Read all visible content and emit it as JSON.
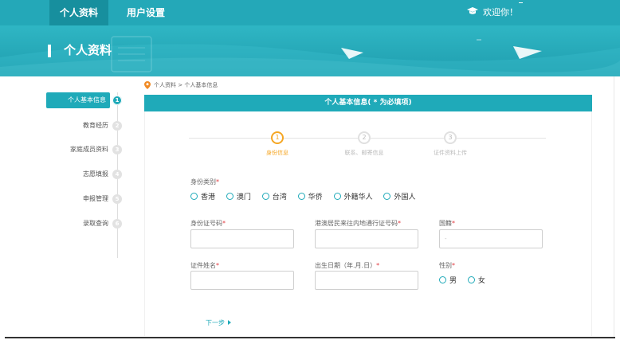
{
  "topbar": {
    "tabs": [
      {
        "label": "个人资料",
        "active": true
      },
      {
        "label": "用户设置",
        "active": false
      }
    ],
    "welcome": "欢迎你！"
  },
  "banner": {
    "title": "个人资料"
  },
  "sidebar": {
    "items": [
      {
        "label": "个人基本信息",
        "num": "1",
        "active": true
      },
      {
        "label": "教育经历",
        "num": "2",
        "active": false
      },
      {
        "label": "家庭成员资料",
        "num": "3",
        "active": false
      },
      {
        "label": "志愿填报",
        "num": "4",
        "active": false
      },
      {
        "label": "申报管理",
        "num": "5",
        "active": false
      },
      {
        "label": "录取查询",
        "num": "6",
        "active": false
      }
    ]
  },
  "breadcrumb": "个人资料 > 个人基本信息",
  "card": {
    "title": "个人基本信息( * 为必填项)"
  },
  "steps": [
    {
      "num": "1",
      "label": "身份信息",
      "active": true
    },
    {
      "num": "2",
      "label": "联系、邮寄信息",
      "active": false
    },
    {
      "num": "3",
      "label": "证件资料上传",
      "active": false
    }
  ],
  "form": {
    "identity_type_label": "身份类别",
    "identity_options": [
      "香港",
      "澳门",
      "台湾",
      "华侨",
      "外籍华人",
      "外国人"
    ],
    "id_number_label": "身份证号码",
    "permit_number_label": "港澳居民来往内地通行证号码",
    "nationality_label": "国籍",
    "nationality_value": "-",
    "cert_name_label": "证件姓名",
    "birthdate_label": "出生日期（年.月.日）",
    "gender_label": "性别",
    "gender_options": [
      "男",
      "女"
    ],
    "required_mark": "*"
  },
  "next_button": "下一步",
  "colors": {
    "primary": "#1faab9",
    "step_active": "#f5a623",
    "required": "#e0393e"
  }
}
